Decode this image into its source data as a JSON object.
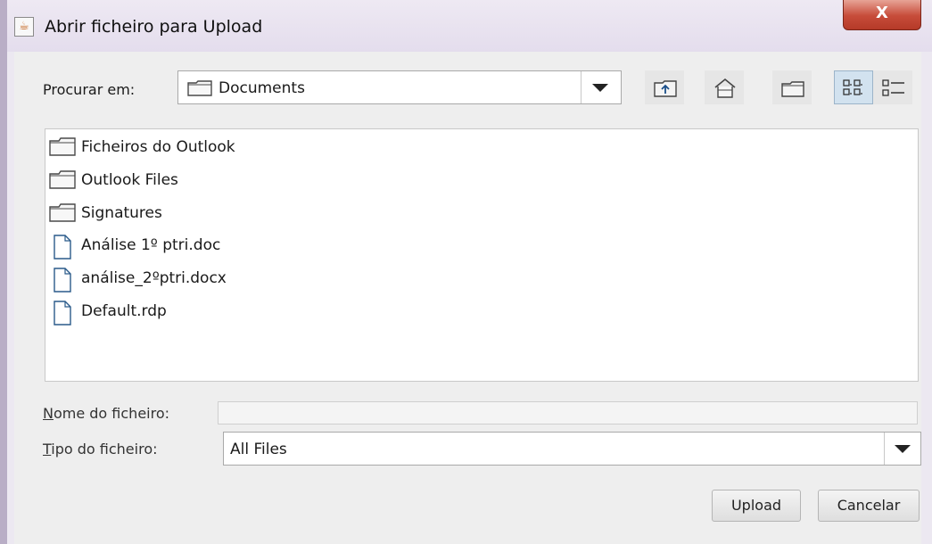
{
  "window": {
    "title": "Abrir ficheiro para Upload",
    "close_label": "X"
  },
  "toolbar": {
    "look_in_label": "Procurar em:",
    "look_in_value": "Documents",
    "buttons": [
      "up-folder-icon",
      "home-icon",
      "new-folder-icon",
      "list-view-icon",
      "details-view-icon"
    ]
  },
  "files": [
    {
      "name": "Ficheiros do Outlook",
      "type": "folder"
    },
    {
      "name": "Outlook Files",
      "type": "folder"
    },
    {
      "name": "Signatures",
      "type": "folder"
    },
    {
      "name": "Análise 1º ptri.doc",
      "type": "file"
    },
    {
      "name": "análise_2ºptri.docx",
      "type": "file"
    },
    {
      "name": "Default.rdp",
      "type": "file"
    }
  ],
  "filename": {
    "label_first": "N",
    "label_rest": "ome do ficheiro:",
    "value": ""
  },
  "filetype": {
    "label_first": "T",
    "label_rest": "ipo do ficheiro:",
    "value": "All Files"
  },
  "actions": {
    "upload_label": "Upload",
    "cancel_label": "Cancelar"
  },
  "colors": {
    "close_button": "#c74c3a",
    "selected_view_button": "#d2e2ef"
  }
}
